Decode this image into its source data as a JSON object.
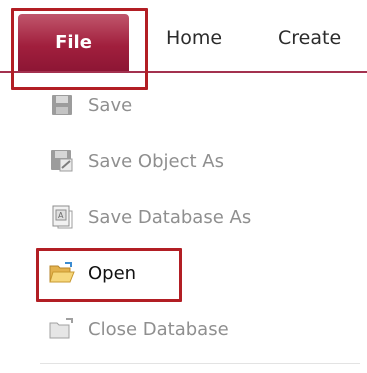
{
  "ribbon": {
    "tabs": [
      {
        "label": "File"
      },
      {
        "label": "Home"
      },
      {
        "label": "Create"
      }
    ]
  },
  "file_menu": {
    "items": [
      {
        "label": "Save",
        "icon": "save-icon",
        "enabled": false
      },
      {
        "label": "Save Object As",
        "icon": "save-object-as-icon",
        "enabled": false
      },
      {
        "label": "Save Database As",
        "icon": "save-database-as-icon",
        "enabled": false
      },
      {
        "label": "Open",
        "icon": "open-folder-icon",
        "enabled": true
      },
      {
        "label": "Close Database",
        "icon": "close-database-icon",
        "enabled": false
      }
    ]
  },
  "colors": {
    "file_tab": "#a11f3d",
    "ribbon_line": "#a3314f",
    "highlight": "#b21e24",
    "disabled_text": "#8f8f8f"
  }
}
